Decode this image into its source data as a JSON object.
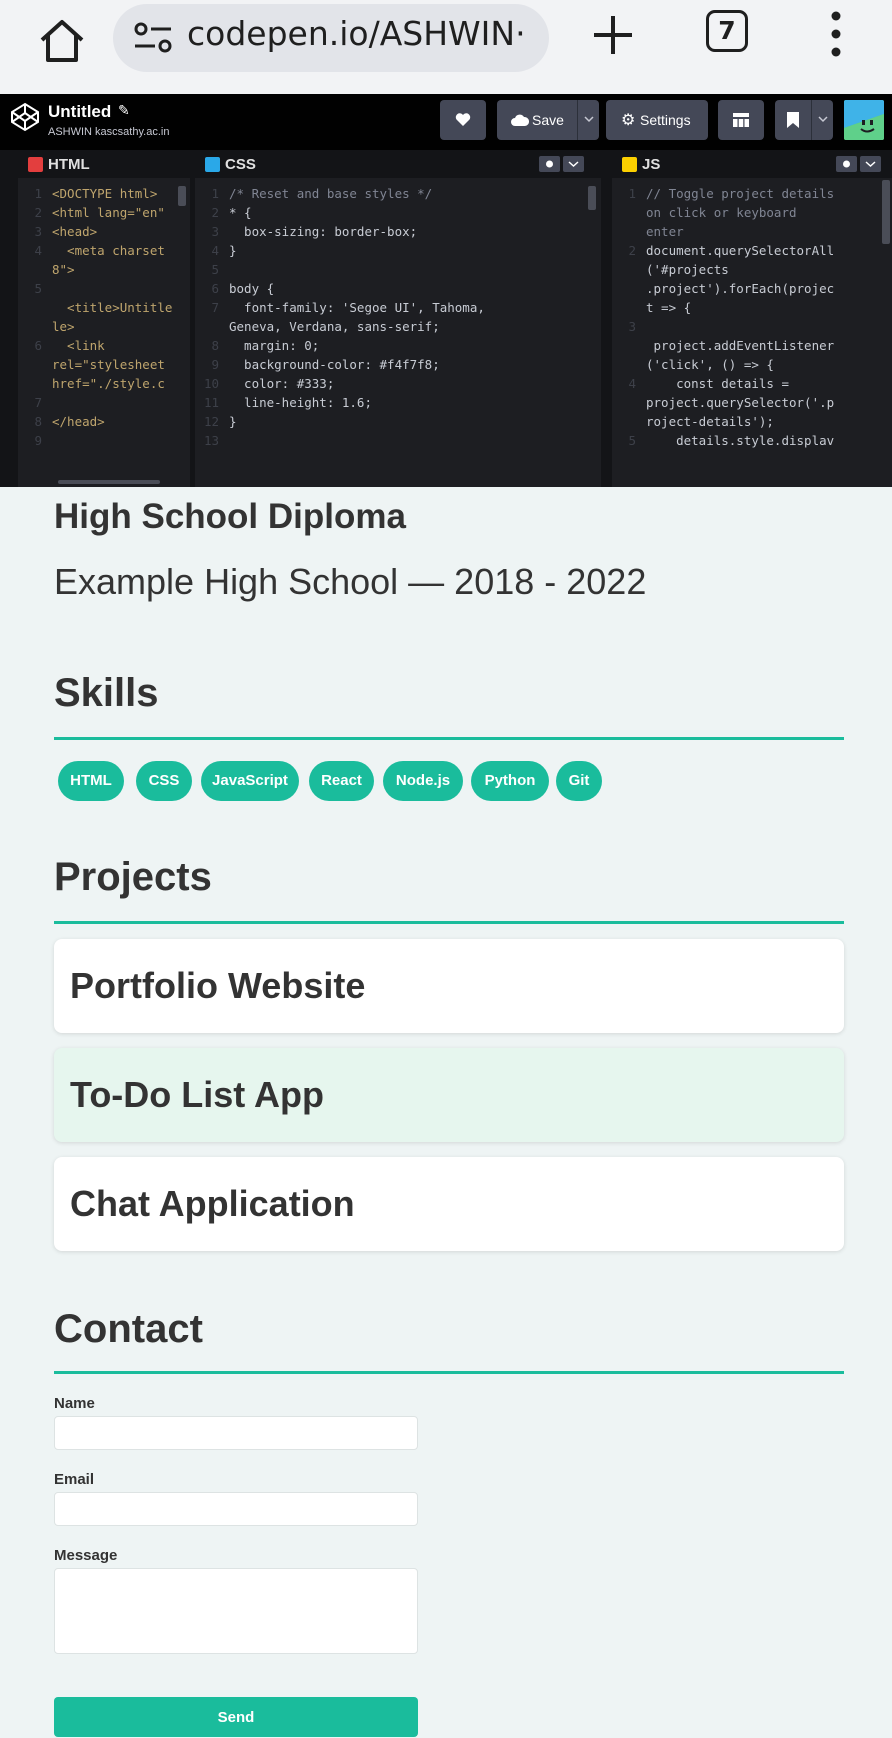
{
  "browser": {
    "url": "codepen.io/ASHWIN·",
    "tab_count": "7"
  },
  "codepen": {
    "title": "Untitled",
    "user": "ASHWIN kascsathy.ac.in",
    "save_label": "Save",
    "settings_label": "Settings"
  },
  "panes": {
    "html": "HTML",
    "css": "CSS",
    "js": "JS"
  },
  "code": {
    "html": [
      {
        "n": "1",
        "t": "<DOCTYPE html>"
      },
      {
        "n": "2",
        "t": "<html lang=\"en\""
      },
      {
        "n": "3",
        "t": "<head>"
      },
      {
        "n": "4",
        "t": "  <meta charset"
      },
      {
        "n": "",
        "t": "8\">"
      },
      {
        "n": "5",
        "t": ""
      },
      {
        "n": "",
        "t": "  <title>Untitle"
      },
      {
        "n": "",
        "t": "le>"
      },
      {
        "n": "6",
        "t": "  <link"
      },
      {
        "n": "",
        "t": "rel=\"stylesheet"
      },
      {
        "n": "",
        "t": "href=\"./style.c"
      },
      {
        "n": "7",
        "t": ""
      },
      {
        "n": "8",
        "t": "</head>"
      },
      {
        "n": "9",
        "t": ""
      }
    ],
    "css": [
      {
        "n": "1",
        "t": "/* Reset and base styles */"
      },
      {
        "n": "2",
        "t": "* {"
      },
      {
        "n": "3",
        "t": "  box-sizing: border-box;"
      },
      {
        "n": "4",
        "t": "}"
      },
      {
        "n": "5",
        "t": ""
      },
      {
        "n": "6",
        "t": "body {"
      },
      {
        "n": "7",
        "t": "  font-family: 'Segoe UI', Tahoma,"
      },
      {
        "n": "",
        "t": "Geneva, Verdana, sans-serif;"
      },
      {
        "n": "8",
        "t": "  margin: 0;"
      },
      {
        "n": "9",
        "t": "  background-color: #f4f7f8;"
      },
      {
        "n": "10",
        "t": "  color: #333;"
      },
      {
        "n": "11",
        "t": "  line-height: 1.6;"
      },
      {
        "n": "12",
        "t": "}"
      },
      {
        "n": "13",
        "t": ""
      }
    ],
    "js": [
      {
        "n": "1",
        "t": "// Toggle project details"
      },
      {
        "n": "",
        "t": "on click or keyboard"
      },
      {
        "n": "",
        "t": "enter"
      },
      {
        "n": "2",
        "t": "document.querySelectorAll"
      },
      {
        "n": "",
        "t": "('#projects"
      },
      {
        "n": "",
        "t": ".project').forEach(projec"
      },
      {
        "n": "",
        "t": "t => {"
      },
      {
        "n": "3",
        "t": ""
      },
      {
        "n": "",
        "t": " project.addEventListener"
      },
      {
        "n": "",
        "t": "('click', () => {"
      },
      {
        "n": "4",
        "t": "    const details ="
      },
      {
        "n": "",
        "t": "project.querySelector('.p"
      },
      {
        "n": "",
        "t": "roject-details');"
      },
      {
        "n": "5",
        "t": "    details.style.displav"
      }
    ]
  },
  "page": {
    "diploma_title": "High School Diploma",
    "diploma_school": "Example High School — 2018 - 2022",
    "skills_heading": "Skills",
    "skills": [
      "HTML",
      "CSS",
      "JavaScript",
      "React",
      "Node.js",
      "Python",
      "Git"
    ],
    "projects_heading": "Projects",
    "projects": [
      "Portfolio Website",
      "To-Do List App",
      "Chat Application"
    ],
    "contact_heading": "Contact",
    "name_label": "Name",
    "email_label": "Email",
    "message_label": "Message",
    "send_label": "Send"
  },
  "colors": {
    "accent": "#1abc9c",
    "page_bg": "#eef4f4",
    "editor_bg": "#1d1e22",
    "highlight_card": "#e6f6ee"
  }
}
